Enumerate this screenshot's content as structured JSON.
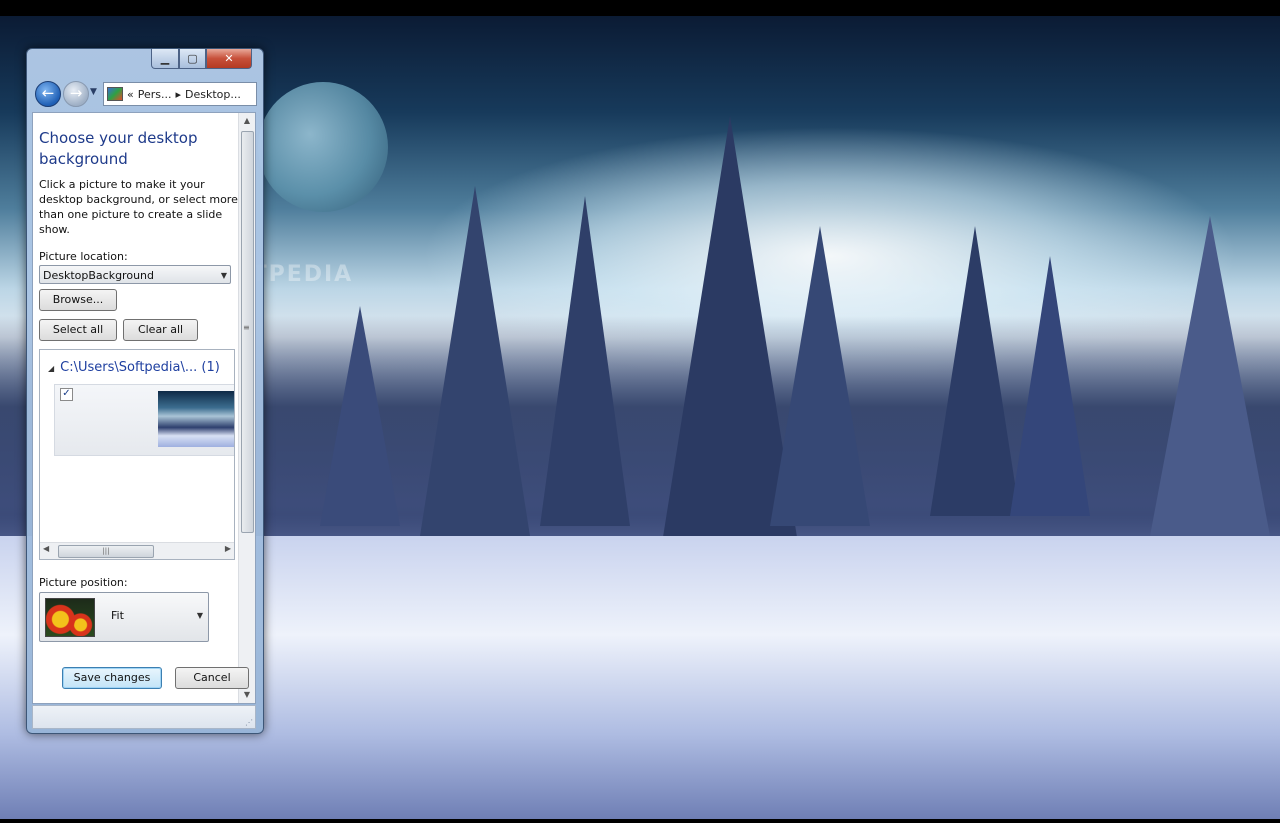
{
  "watermark": "SOFTPEDIA",
  "window": {
    "caption_buttons": {
      "minimize": "▁",
      "maximize": "▢",
      "close": "✕"
    },
    "nav": {
      "back": "←",
      "forward": "→",
      "breadcrumb": [
        "«",
        "Pers...",
        "▸",
        "Desktop..."
      ]
    },
    "heading": "Choose your desktop background",
    "description": "Click a picture to make it your desktop background, or select more than one picture to create a slide show.",
    "picture_location_label": "Picture location:",
    "picture_location_value": "DesktopBackground",
    "browse_label": "Browse...",
    "select_all_label": "Select all",
    "clear_all_label": "Clear all",
    "gallery": {
      "group_header": "C:\\Users\\Softpedia\\... (1)",
      "items": [
        {
          "checked": true
        }
      ]
    },
    "picture_position_label": "Picture position:",
    "picture_position_value": "Fit",
    "save_label": "Save changes",
    "cancel_label": "Cancel"
  }
}
